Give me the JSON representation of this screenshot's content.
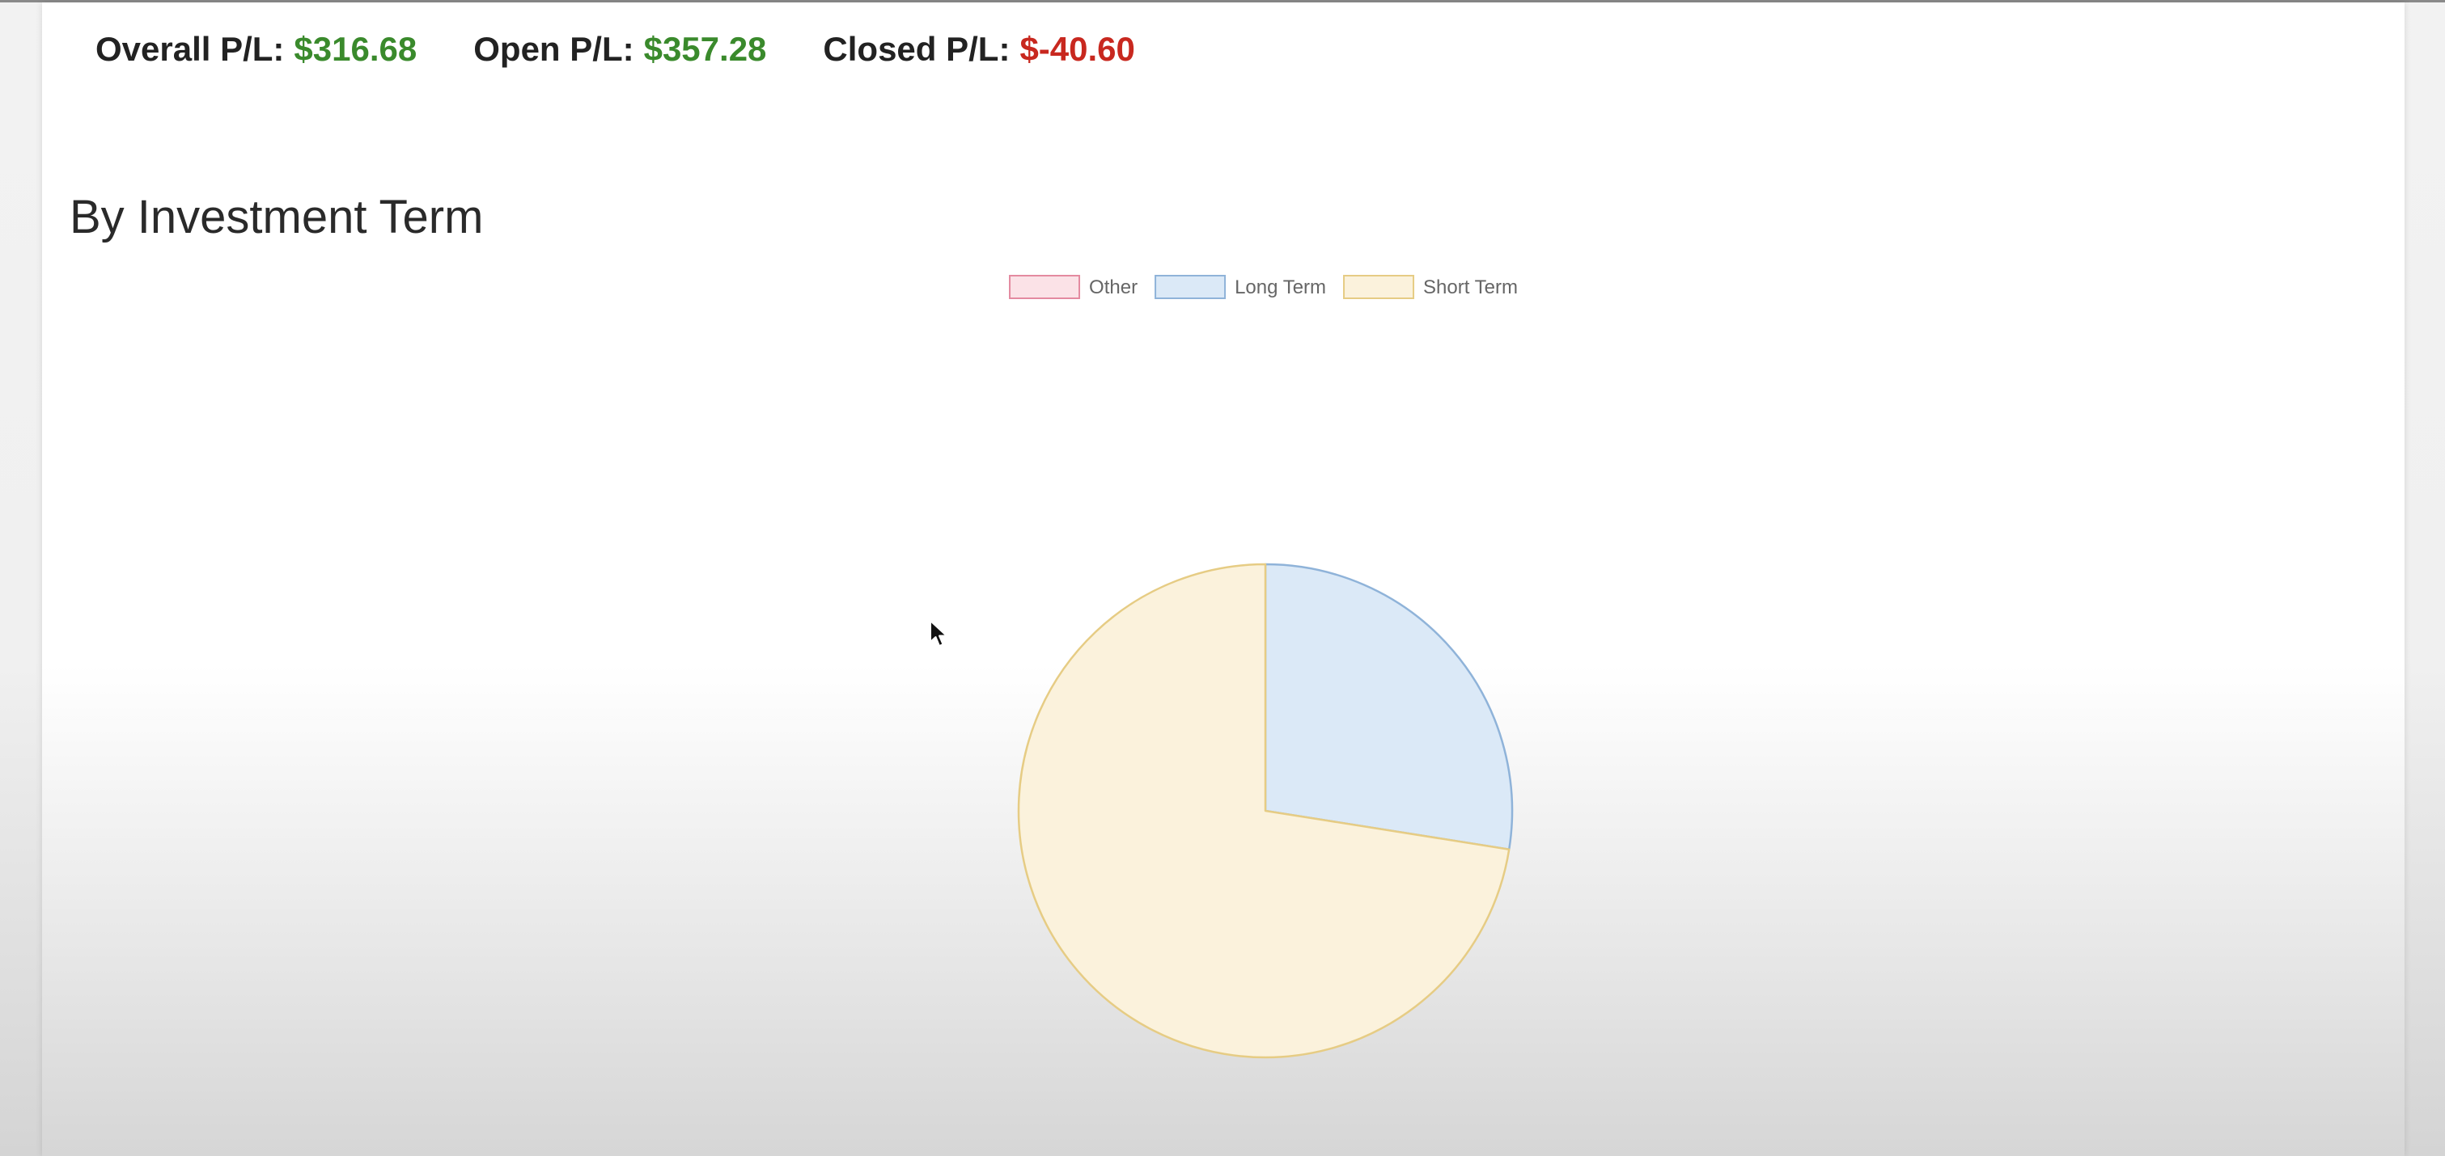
{
  "summary": {
    "overall_label": "Overall P/L:",
    "overall_value": "$316.68",
    "open_label": "Open P/L:",
    "open_value": "$357.28",
    "closed_label": "Closed P/L:",
    "closed_value": "$-40.60"
  },
  "section": {
    "title": "By Investment Term"
  },
  "colors": {
    "positive": "#3a8a2c",
    "negative": "#c8281f"
  },
  "chart_data": {
    "type": "pie",
    "legend_position": "top",
    "slices": [
      {
        "label": "Other",
        "value": 0,
        "fill": "#fbe2e7",
        "stroke": "#e48aa0"
      },
      {
        "label": "Long Term",
        "value": 27.5,
        "fill": "#dbe9f7",
        "stroke": "#8fb3d9"
      },
      {
        "label": "Short Term",
        "value": 72.5,
        "fill": "#fbf2dc",
        "stroke": "#e6cc84"
      }
    ]
  }
}
